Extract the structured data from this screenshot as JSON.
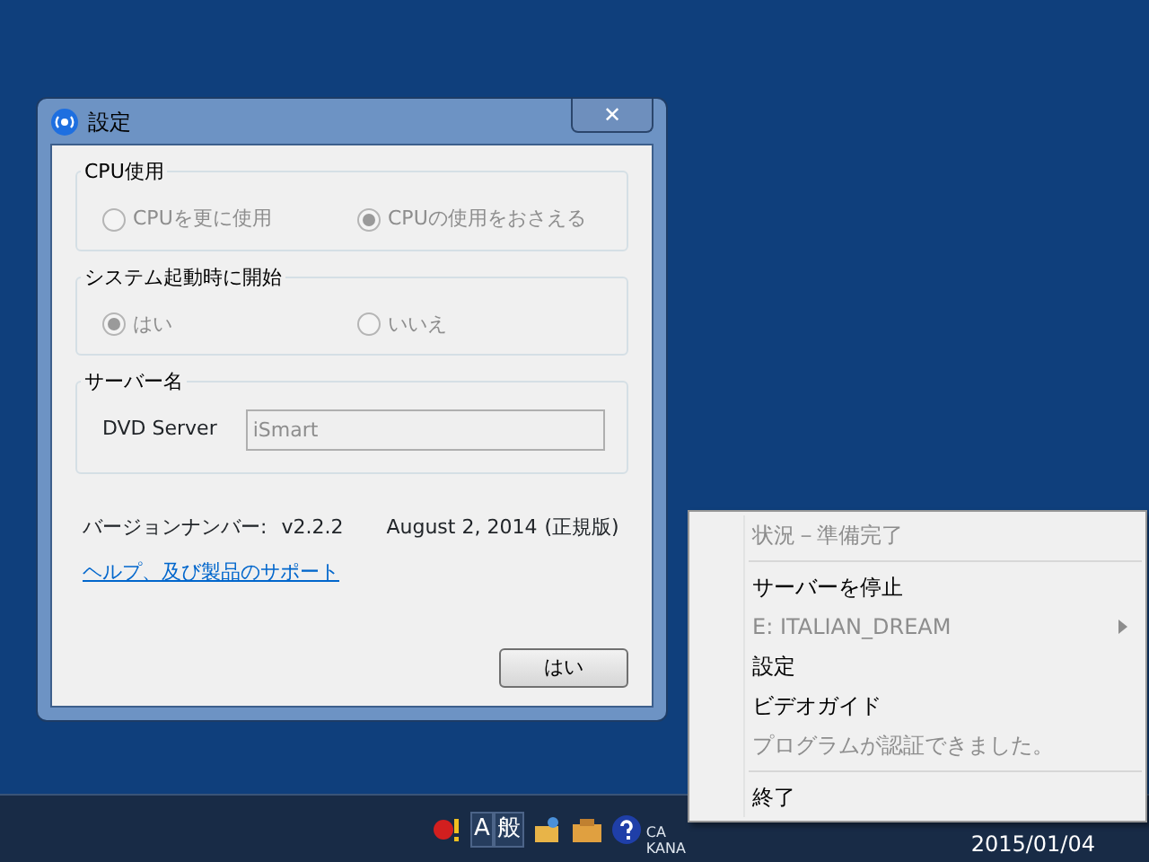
{
  "dialog": {
    "title": "設定",
    "close_button": "✕",
    "groups": [
      {
        "kind": "radios",
        "title": "CPU使用",
        "options": [
          {
            "label": "CPUを更に使用",
            "selected": false,
            "disabled": true
          },
          {
            "label": "CPUの使用をおさえる",
            "selected": true,
            "disabled": true
          }
        ]
      },
      {
        "kind": "radios",
        "title": "システム起動時に開始",
        "options": [
          {
            "label": "はい",
            "selected": true,
            "disabled": true
          },
          {
            "label": "いいえ",
            "selected": false,
            "disabled": true
          }
        ]
      },
      {
        "kind": "field",
        "title": "サーバー名",
        "label": "DVD Server",
        "value": "iSmart",
        "disabled": true
      }
    ],
    "version_label": "バージョンナンバー:",
    "version": "v2.2.2",
    "date": "August 2, 2014",
    "edition": "(正規版)",
    "help_link": "ヘルプ、及び製品のサポート",
    "ok_button": "はい"
  },
  "context_menu": {
    "items": [
      {
        "kind": "item",
        "label": "状況－準備完了",
        "disabled": true,
        "submenu": false
      },
      {
        "kind": "separator"
      },
      {
        "kind": "item",
        "label": "サーバーを停止",
        "disabled": false,
        "submenu": false
      },
      {
        "kind": "item",
        "label": "E: ITALIAN_DREAM",
        "disabled": true,
        "submenu": true
      },
      {
        "kind": "item",
        "label": "設定",
        "disabled": false,
        "submenu": false
      },
      {
        "kind": "item",
        "label": "ビデオガイド",
        "disabled": false,
        "submenu": false
      },
      {
        "kind": "item",
        "label": "プログラムが認証できました。",
        "disabled": true,
        "submenu": false
      },
      {
        "kind": "separator"
      },
      {
        "kind": "item",
        "label": "終了",
        "disabled": false,
        "submenu": false
      }
    ]
  },
  "taskbar": {
    "ime_mode": "A",
    "ime_input": "般",
    "caps_label": "CA",
    "kana_label": "KANA",
    "date": "2015/01/04"
  }
}
